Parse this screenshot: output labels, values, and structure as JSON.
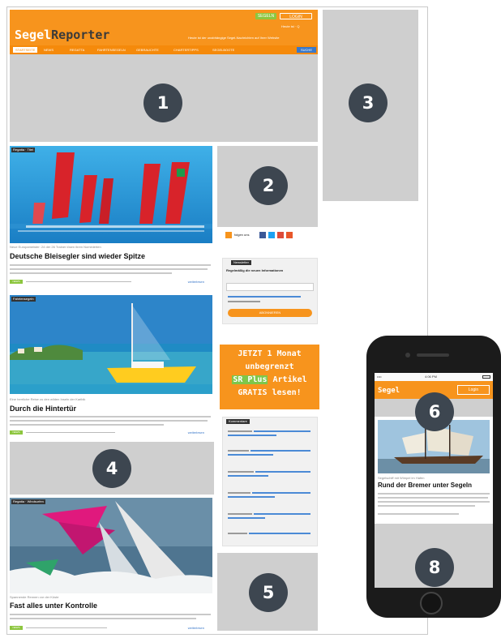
{
  "desktop": {
    "logo": {
      "part1": "Segel",
      "part2": "Reporter"
    },
    "header": {
      "buttons": [
        "SEGELN",
        "LOGIN"
      ],
      "topline": "Heute ist · Q",
      "tagline": "Heute ist der unabhängige Segel-Nachrichten auf Ihrer Website"
    },
    "nav": {
      "items": [
        "STARTSEITE",
        "NEWS",
        "REGATTA",
        "FAHRTENSEGELN",
        "GEBRAUCHTE",
        "CHARTERTIPPS",
        "SEGELBOOTE"
      ],
      "search": "SUCHE"
    },
    "articles": [
      {
        "tag": "Regatta · Titel",
        "caption": "Neue Europameister: 24 der 26 Trainer lösen ihren Nominierten",
        "headline": "Deutsche Bleisegler sind wieder Spitze",
        "badge": "NEWS",
        "more": "weiterlesen"
      },
      {
        "tag": "Fahrtensegeln",
        "caption": "Eine herrliche Reise zu den wilden Inseln der Karibik",
        "headline": "Durch die Hintertür",
        "badge": "NEWS",
        "more": "weiterlesen"
      },
      {
        "tag": "Regatta · Windsurfen",
        "caption": "Spannende Rennen vor der Küste",
        "headline": "Fast alles unter Kontrolle",
        "badge": "NEWS",
        "more": "weiterlesen"
      }
    ],
    "social": {
      "label": "folgen uns"
    },
    "newsletter": {
      "title": "Newsletter",
      "text": "Regelmäßig die neuen Informationen",
      "button": "ABONNIEREN"
    },
    "promo": {
      "line1": "JETZT 1 Monat",
      "line2": "unbegrenzt",
      "highlight": "SR Plus",
      "line3_rest": " Artikel",
      "line4": "GRATIS lesen!"
    },
    "comments": {
      "title": "Kommentare"
    }
  },
  "mobile": {
    "status": {
      "carrier": "•••• ",
      "time": "4:06 PM"
    },
    "logo": "Segel",
    "login": "Login",
    "caption": "Segelschiff mit Wimpel im Hafen",
    "headline": "Rund der Bremer unter Segeln"
  },
  "markers": [
    "1",
    "2",
    "3",
    "4",
    "5",
    "6",
    "8"
  ]
}
